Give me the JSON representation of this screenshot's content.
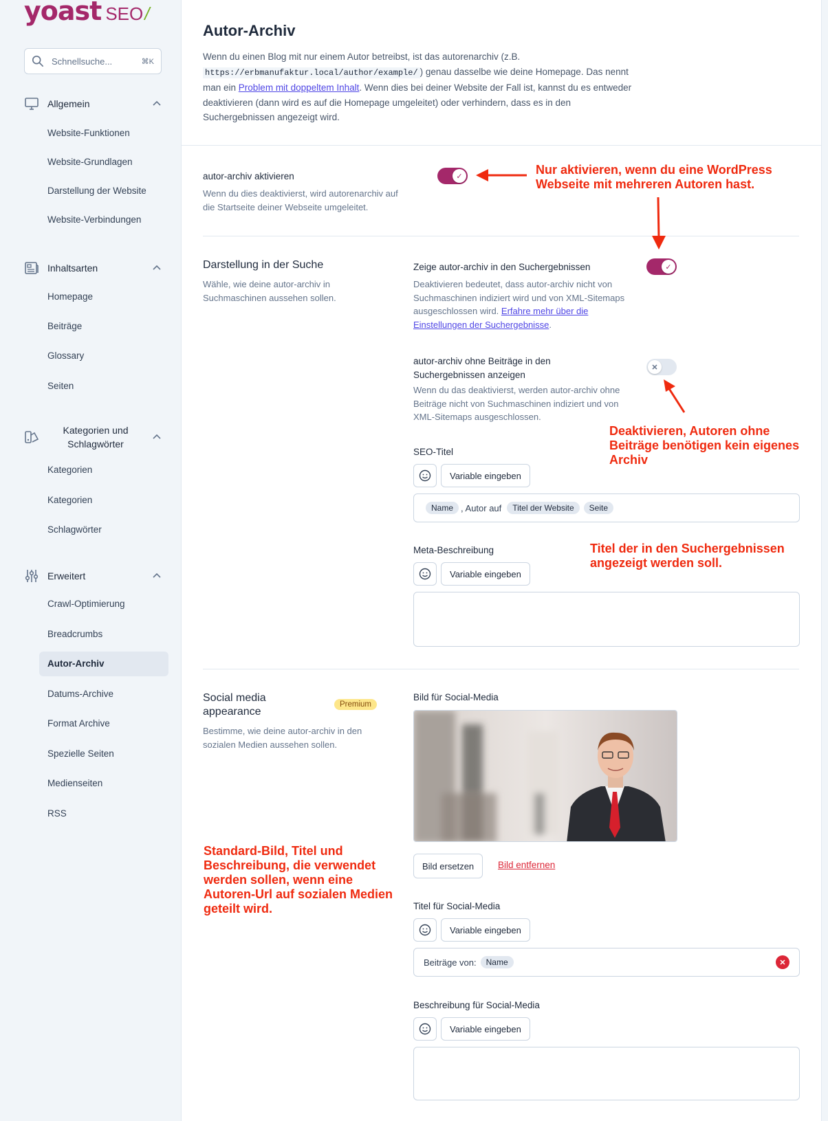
{
  "logo": {
    "brand": "yoast",
    "product": "SEO",
    "slash": "/"
  },
  "search": {
    "placeholder": "Schnellsuche...",
    "shortcut": "⌘K"
  },
  "sidebar": {
    "sections": [
      {
        "label": "Allgemein",
        "items": [
          "Website-Funktionen",
          "Website-Grundlagen",
          "Darstellung der Website",
          "Website-Verbindungen"
        ]
      },
      {
        "label": "Inhaltsarten",
        "items": [
          "Homepage",
          "Beiträge",
          "Glossary",
          "Seiten"
        ]
      },
      {
        "label_line1": "Kategorien und",
        "label_line2": "Schlagwörter",
        "items": [
          "Kategorien",
          "Kategorien",
          "Schlagwörter"
        ]
      },
      {
        "label": "Erweitert",
        "items": [
          "Crawl-Optimierung",
          "Breadcrumbs",
          "Autor-Archiv",
          "Datums-Archive",
          "Format Archive",
          "Spezielle Seiten",
          "Medienseiten",
          "RSS"
        ]
      }
    ],
    "active_item": "Autor-Archiv"
  },
  "page": {
    "title": "Autor-Archiv",
    "intro_1": "Wenn du einen Blog mit nur einem Autor betreibst, ist das autorenarchiv (z.B.",
    "intro_code": "https://erbmanufaktur.local/author/example/",
    "intro_2": ") genau dasselbe wie deine Homepage. Das nennt man ein",
    "intro_link": "Problem mit doppeltem Inhalt",
    "intro_3": ". Wenn dies bei deiner Website der Fall ist, kannst du es entweder deaktivieren (dann wird es auf die Homepage umgeleitet) oder verhindern, dass es in den Suchergebnissen angezeigt wird."
  },
  "activate": {
    "label": "autor-archiv aktivieren",
    "desc": "Wenn du dies deaktivierst, wird autorenarchiv auf die Startseite deiner Webseite umgeleitet.",
    "enabled": true
  },
  "search_appearance": {
    "title": "Darstellung in der Suche",
    "desc": "Wähle, wie deine autor-archiv in Suchmaschinen aussehen sollen.",
    "show_label": "Zeige autor-archiv in den Suchergebnissen",
    "show_desc": "Deaktivieren bedeutet, dass autor-archiv nicht von Suchmaschinen indiziert wird und von XML-Sitemaps ausgeschlossen wird.",
    "show_link": "Erfahre mehr über die Einstellungen der Suchergebnisse",
    "show_enabled": true,
    "noposts_label": "autor-archiv ohne Beiträge in den Suchergebnissen anzeigen",
    "noposts_desc": "Wenn du das deaktivierst, werden autor-archiv ohne Beiträge nicht von Suchmaschinen indiziert und von XML-Sitemaps ausgeschlossen.",
    "noposts_enabled": false,
    "seo_title_label": "SEO-Titel",
    "variable_button": "Variable eingeben",
    "seo_title": {
      "pill1": "Name",
      "text": ", Autor auf",
      "pill2": "Titel der Website",
      "pill3": "Seite"
    },
    "meta_label": "Meta-Beschreibung",
    "meta_value": ""
  },
  "social": {
    "title": "Social media appearance",
    "badge": "Premium",
    "desc": "Bestimme, wie deine autor-archiv in den sozialen Medien aussehen sollen.",
    "image_label": "Bild für Social-Media",
    "replace_button": "Bild ersetzen",
    "remove_link": "Bild entfernen",
    "title_label": "Titel für Social-Media",
    "title_text": "Beiträge von:",
    "title_pill": "Name",
    "desc_label": "Beschreibung für Social-Media",
    "desc_value": ""
  },
  "annotations": {
    "a1": "Nur aktivieren, wenn du eine WordPress Webseite mit mehreren Autoren hast.",
    "a2": "Deaktivieren, Autoren ohne Beiträge benötigen kein eigenes Archiv",
    "a3": "Titel der in den Suchergebnissen angezeigt werden soll.",
    "a4": "Standard-Bild, Titel und Beschreibung, die verwendet werden sollen, wenn eine Autoren-Url auf sozialen Medien geteilt wird."
  },
  "colors": {
    "brand": "#a4286a",
    "link": "#4f46e5",
    "annotation": "#ef2a0f",
    "premium": "#fde68a"
  }
}
